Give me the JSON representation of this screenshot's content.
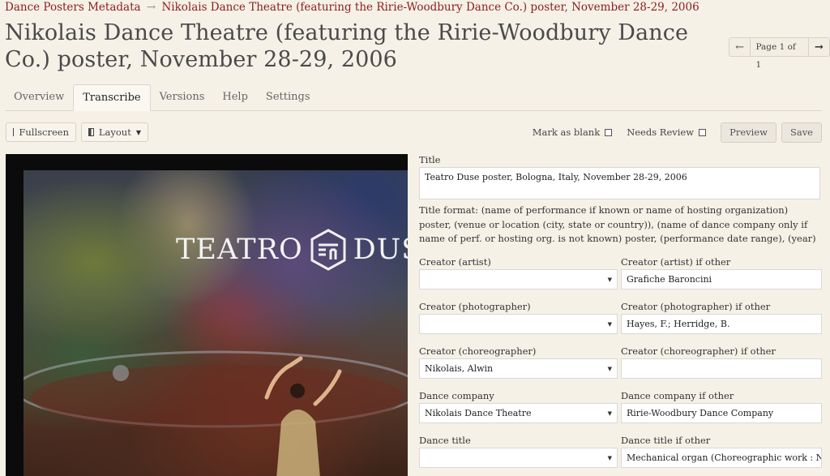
{
  "breadcrumb": {
    "parent": "Dance Posters Metadata",
    "arrow": "→",
    "current": "Nikolais Dance Theatre (featuring the Ririe-Woodbury Dance Co.) poster, November 28-29, 2006"
  },
  "page_title": "Nikolais Dance Theatre (featuring the Ririe-Woodbury Dance Co.) poster, November 28-29, 2006",
  "pager": {
    "prev_icon": "arrow-left-icon",
    "label": "Page 1 of 1",
    "next_icon": "arrow-right-icon"
  },
  "tabs": [
    {
      "label": "Overview",
      "active": false
    },
    {
      "label": "Transcribe",
      "active": true
    },
    {
      "label": "Versions",
      "active": false
    },
    {
      "label": "Help",
      "active": false
    },
    {
      "label": "Settings",
      "active": false
    }
  ],
  "toolbar": {
    "fullscreen_label": "Fullscreen",
    "layout_label": "Layout",
    "mark_blank_label": "Mark as blank",
    "needs_review_label": "Needs Review",
    "preview_label": "Preview",
    "save_label": "Save"
  },
  "image": {
    "poster_text_left": "TEATRO",
    "poster_text_right": "DUSE"
  },
  "form": {
    "title_label": "Title",
    "title_value": "Teatro Duse poster, Bologna, Italy, November 28-29, 2006",
    "title_help": "Title format: (name of performance if known or name of hosting organization) poster, (venue or location (city, state or country)), (name of dance company only if name of perf. or hosting org. is not known) poster, (performance date range), (year)",
    "rows": [
      {
        "left_label": "Creator (artist)",
        "left_value": "",
        "right_label": "Creator (artist) if other",
        "right_value": "Grafiche Baroncini"
      },
      {
        "left_label": "Creator (photographer)",
        "left_value": "",
        "right_label": "Creator (photographer) if other",
        "right_value": "Hayes, F.; Herridge, B."
      },
      {
        "left_label": "Creator (choreographer)",
        "left_value": "Nikolais, Alwin",
        "right_label": "Creator (choreographer) if other",
        "right_value": ""
      },
      {
        "left_label": "Dance company",
        "left_value": "Nikolais Dance Theatre",
        "right_label": "Dance company if other",
        "right_value": "Ririe-Woodbury Dance Company"
      },
      {
        "left_label": "Dance title",
        "left_value": "",
        "right_label": "Dance title if other",
        "right_value": "Mechanical organ (Choreographic work : Nikolais)"
      }
    ]
  }
}
